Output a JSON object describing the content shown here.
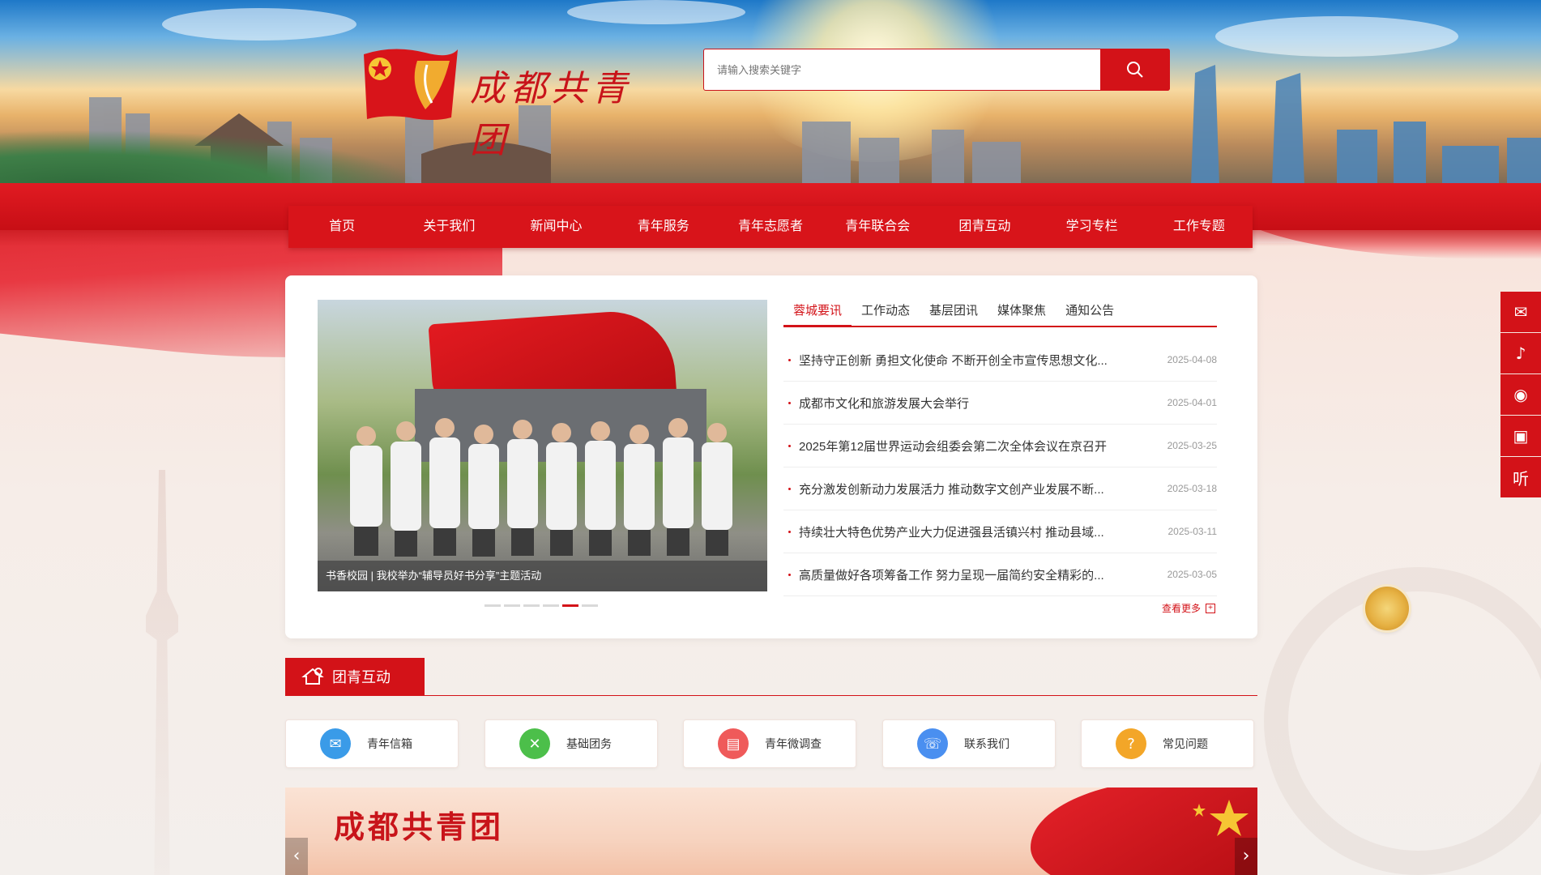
{
  "header": {
    "logo_text": "成都共青团",
    "search": {
      "placeholder": "请输入搜索关键字"
    }
  },
  "nav": {
    "items": [
      "首页",
      "关于我们",
      "新闻中心",
      "青年服务",
      "青年志愿者",
      "青年联合会",
      "团青互动",
      "学习专栏",
      "工作专题"
    ]
  },
  "carousel": {
    "caption": "书香校园 | 我校举办“辅导员好书分享”主题活动",
    "dot_count": 6,
    "active_index": 4
  },
  "news": {
    "tabs": [
      "蓉城要讯",
      "工作动态",
      "基层团讯",
      "媒体聚焦",
      "通知公告"
    ],
    "active_tab": 0,
    "items": [
      {
        "title": "坚持守正创新 勇担文化使命 不断开创全市宣传思想文化...",
        "date": "2025-04-08"
      },
      {
        "title": "成都市文化和旅游发展大会举行",
        "date": "2025-04-01"
      },
      {
        "title": "2025年第12届世界运动会组委会第二次全体会议在京召开",
        "date": "2025-03-25"
      },
      {
        "title": "充分激发创新动力发展活力 推动数字文创产业发展不断...",
        "date": "2025-03-18"
      },
      {
        "title": "持续壮大特色优势产业大力促进强县活镇兴村 推动县域...",
        "date": "2025-03-11"
      },
      {
        "title": "高质量做好各项筹备工作 努力呈现一届简约安全精彩的...",
        "date": "2025-03-05"
      }
    ],
    "more_label": "查看更多"
  },
  "interaction": {
    "title": "团青互动",
    "services": [
      {
        "label": "青年信箱",
        "icon": "mail-icon",
        "color": "#3a9be8"
      },
      {
        "label": "基础团务",
        "icon": "puzzle-icon",
        "color": "#4cbf4a"
      },
      {
        "label": "青年微调查",
        "icon": "survey-icon",
        "color": "#ef5a5a"
      },
      {
        "label": "联系我们",
        "icon": "phone-icon",
        "color": "#4a8ff0"
      },
      {
        "label": "常见问题",
        "icon": "question-icon",
        "color": "#f3a628"
      }
    ]
  },
  "banner": {
    "title": "成都共青团"
  },
  "sidebar": {
    "items": [
      {
        "icon": "wechat-icon",
        "glyph": "✉"
      },
      {
        "icon": "douyin-icon",
        "glyph": "♪"
      },
      {
        "icon": "weibo-icon",
        "glyph": "◉"
      },
      {
        "icon": "bilibili-icon",
        "glyph": "▣"
      },
      {
        "icon": "listen-icon",
        "glyph": "听"
      }
    ]
  },
  "colors": {
    "brand_red": "#d31218",
    "accent_gold": "#e6b143"
  }
}
